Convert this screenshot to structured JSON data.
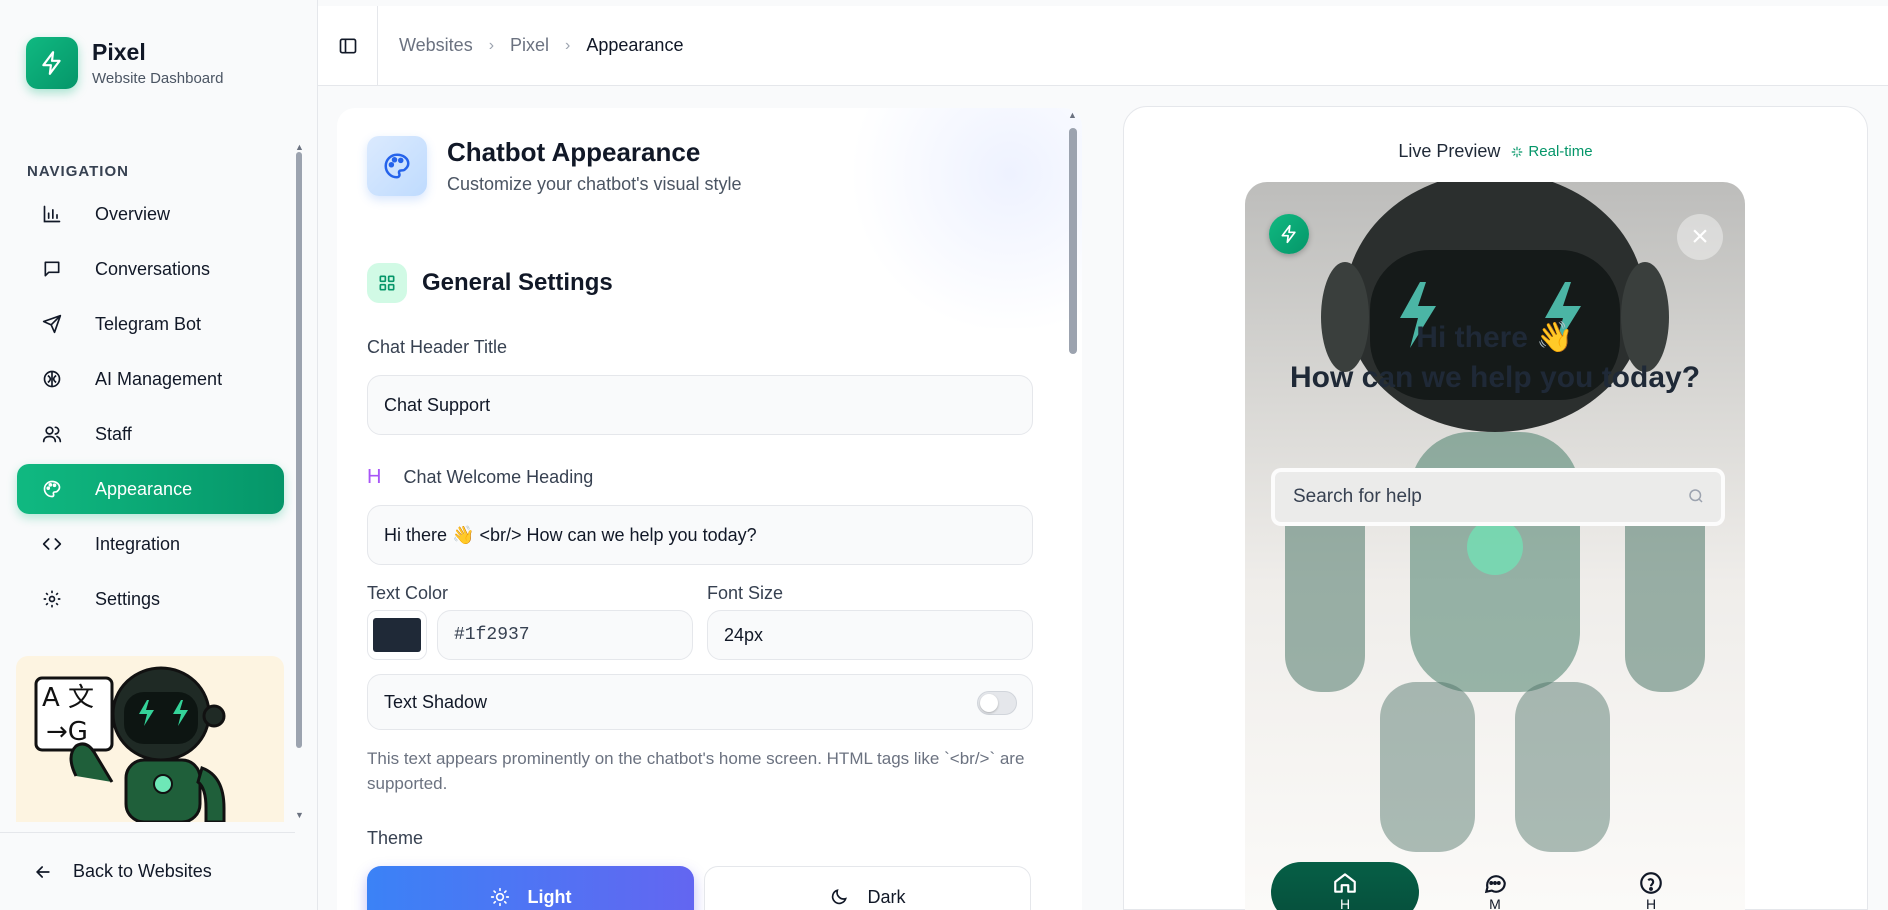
{
  "brand": {
    "name": "Pixel",
    "subtitle": "Website Dashboard"
  },
  "nav": {
    "heading": "NAVIGATION",
    "items": [
      {
        "label": "Overview",
        "icon": "bar-chart-icon"
      },
      {
        "label": "Conversations",
        "icon": "message-square-icon"
      },
      {
        "label": "Telegram Bot",
        "icon": "send-icon"
      },
      {
        "label": "AI Management",
        "icon": "brain-icon"
      },
      {
        "label": "Staff",
        "icon": "users-icon"
      },
      {
        "label": "Appearance",
        "icon": "palette-icon",
        "active": true
      },
      {
        "label": "Integration",
        "icon": "code-icon"
      },
      {
        "label": "Settings",
        "icon": "gear-icon"
      }
    ],
    "back_label": "Back to Websites"
  },
  "promo": {
    "translate_glyphs_top": "A 文",
    "translate_glyphs_bottom": "→G"
  },
  "breadcrumbs": [
    "Websites",
    "Pixel",
    "Appearance"
  ],
  "appearance": {
    "title": "Chatbot Appearance",
    "subtitle": "Customize your chatbot's visual style",
    "section_title": "General Settings",
    "header_title_label": "Chat Header Title",
    "header_title_value": "Chat Support",
    "welcome_label_prefix": "H",
    "welcome_label": "Chat Welcome Heading",
    "welcome_value": "Hi there 👋 <br/> How can we help you today?",
    "text_color_label": "Text Color",
    "text_color_value": "#1f2937",
    "font_size_label": "Font Size",
    "font_size_value": "24px",
    "text_shadow_label": "Text Shadow",
    "text_shadow_enabled": false,
    "help_text": "This text appears prominently on the chatbot's home screen. HTML tags like `<br/>` are supported.",
    "theme_label": "Theme",
    "theme_options": [
      "Light",
      "Dark"
    ],
    "theme_selected": "Light"
  },
  "preview": {
    "title": "Live Preview",
    "badge": "Real-time",
    "heading_line1": "Hi there 👋",
    "heading_line2": "How can we help you today?",
    "search_placeholder": "Search for help",
    "nav_visible_fragments": [
      "H",
      "M",
      "H"
    ]
  },
  "colors": {
    "accent": "#10b981",
    "accent_dark": "#059669",
    "theme_active": "#4f6ef7",
    "text_color": "#1f2937"
  }
}
